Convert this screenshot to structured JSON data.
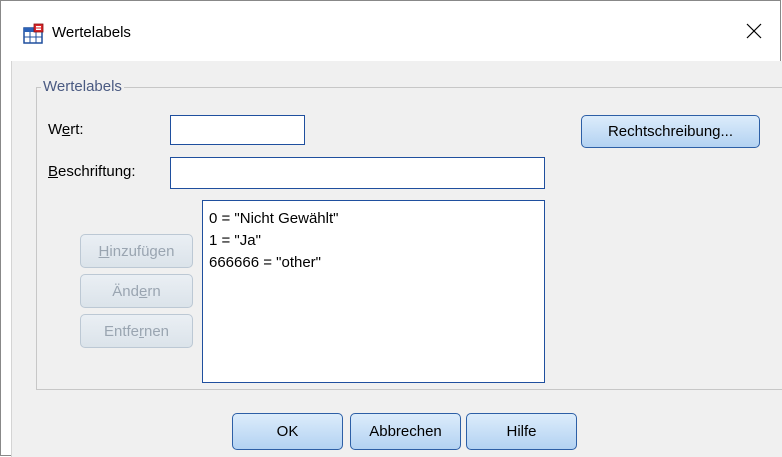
{
  "window": {
    "title": "Wertelabels",
    "close_glyph": "✕"
  },
  "group": {
    "legend": "Wertelabels"
  },
  "fields": {
    "wert": {
      "label_pre": "W",
      "label_mnemonic": "e",
      "label_post": "rt:",
      "value": ""
    },
    "beschriftung": {
      "label_pre": "",
      "label_mnemonic": "B",
      "label_post": "eschriftung:",
      "value": ""
    }
  },
  "buttons": {
    "spelling": "Rechtschreibung...",
    "add": {
      "pre": "",
      "mnemonic": "H",
      "post": "inzufügen"
    },
    "change": {
      "pre": "Änd",
      "mnemonic": "e",
      "post": "rn"
    },
    "remove": {
      "pre": "Entfe",
      "mnemonic": "r",
      "post": "nen"
    },
    "ok": "OK",
    "cancel": "Abbrechen",
    "help": "Hilfe"
  },
  "value_labels": [
    "0 = \"Nicht Gewählt\"",
    "1 = \"Ja\"",
    "666666 = \"other\""
  ],
  "icons": {
    "app": "value-labels-table-icon",
    "close": "close-icon"
  }
}
